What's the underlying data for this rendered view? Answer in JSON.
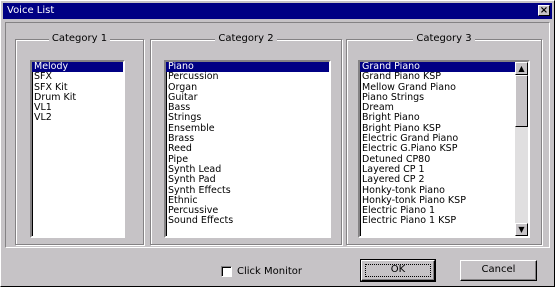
{
  "window": {
    "title": "Voice List",
    "close_glyph": "×"
  },
  "category1": {
    "label": "Category 1",
    "items": [
      "Melody",
      "SFX",
      "SFX Kit",
      "Drum Kit",
      "VL1",
      "VL2"
    ],
    "selected_index": 0
  },
  "category2": {
    "label": "Category 2",
    "items": [
      "Piano",
      "Percussion",
      "Organ",
      "Guitar",
      "Bass",
      "Strings",
      "Ensemble",
      "Brass",
      "Reed",
      "Pipe",
      "Synth Lead",
      "Synth Pad",
      "Synth Effects",
      "Ethnic",
      "Percussive",
      "Sound Effects"
    ],
    "selected_index": 0
  },
  "category3": {
    "label": "Category 3",
    "items": [
      "Grand Piano",
      "Grand Piano KSP",
      "Mellow Grand Piano",
      "Piano Strings",
      "Dream",
      "Bright Piano",
      "Bright Piano KSP",
      "Electric Grand Piano",
      "Electric G.Piano KSP",
      "Detuned CP80",
      "Layered CP 1",
      "Layered CP 2",
      "Honky-tonk Piano",
      "Honky-tonk Piano KSP",
      "Electric Piano 1",
      "Electric Piano 1 KSP"
    ],
    "selected_index": 0,
    "scroll_up_glyph": "▲",
    "scroll_down_glyph": "▼"
  },
  "footer": {
    "click_monitor_label": "Click Monitor",
    "click_monitor_checked": false,
    "ok_label": "OK",
    "cancel_label": "Cancel"
  },
  "colors": {
    "title_bar": "#000084",
    "selection": "#000084",
    "face": "#c6c3c6"
  }
}
